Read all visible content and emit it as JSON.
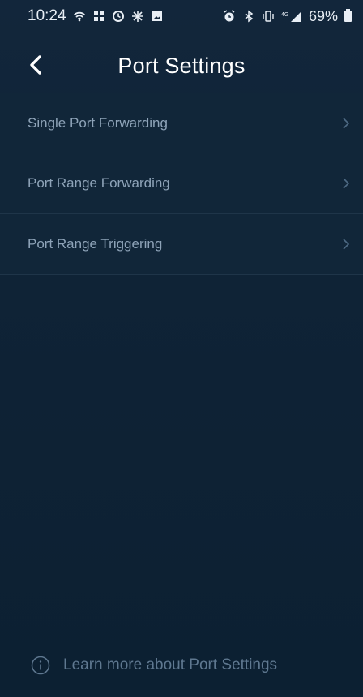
{
  "status_bar": {
    "time": "10:24",
    "left_icons": [
      "wifi-calling-icon",
      "grid-icon",
      "clock-app-icon",
      "snowflake-icon",
      "photo-icon"
    ],
    "right_icons": [
      "alarm-icon",
      "bluetooth-icon",
      "vibrate-icon",
      "lte-signal-icon"
    ],
    "battery": "69%"
  },
  "header": {
    "title": "Port Settings",
    "back_icon": "chevron-left-icon"
  },
  "menu": {
    "items": [
      {
        "label": "Single Port Forwarding",
        "icon": "chevron-right-icon"
      },
      {
        "label": "Port Range Forwarding",
        "icon": "chevron-right-icon"
      },
      {
        "label": "Port Range Triggering",
        "icon": "chevron-right-icon"
      }
    ]
  },
  "footer": {
    "icon": "info-icon",
    "link_text": "Learn more about Port Settings"
  },
  "colors": {
    "background": "#0f2336",
    "row_background": "#112639",
    "row_divider": "#1f3549",
    "label_text": "#8ea3b8",
    "footer_text": "#5f7890",
    "title_text": "#ffffff"
  }
}
